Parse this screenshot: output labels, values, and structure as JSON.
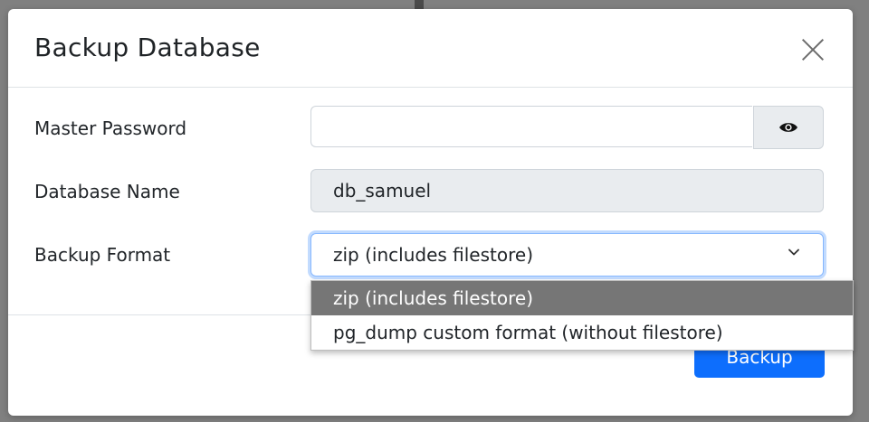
{
  "dialog": {
    "title": "Backup Database"
  },
  "form": {
    "master_password": {
      "label": "Master Password",
      "value": ""
    },
    "database_name": {
      "label": "Database Name",
      "value": "db_samuel"
    },
    "backup_format": {
      "label": "Backup Format",
      "selected": "zip (includes filestore)",
      "options": [
        "zip (includes filestore)",
        "pg_dump custom format (without filestore)"
      ]
    }
  },
  "footer": {
    "backup_label": "Backup"
  },
  "colors": {
    "primary": "#0d6efd",
    "focus_border": "#86b7fe",
    "readonly_bg": "#e9ecef",
    "selected_option_bg": "#767676"
  },
  "icons": {
    "close": "close-icon",
    "toggle_password": "eye-icon",
    "dropdown": "chevron-down-icon"
  }
}
